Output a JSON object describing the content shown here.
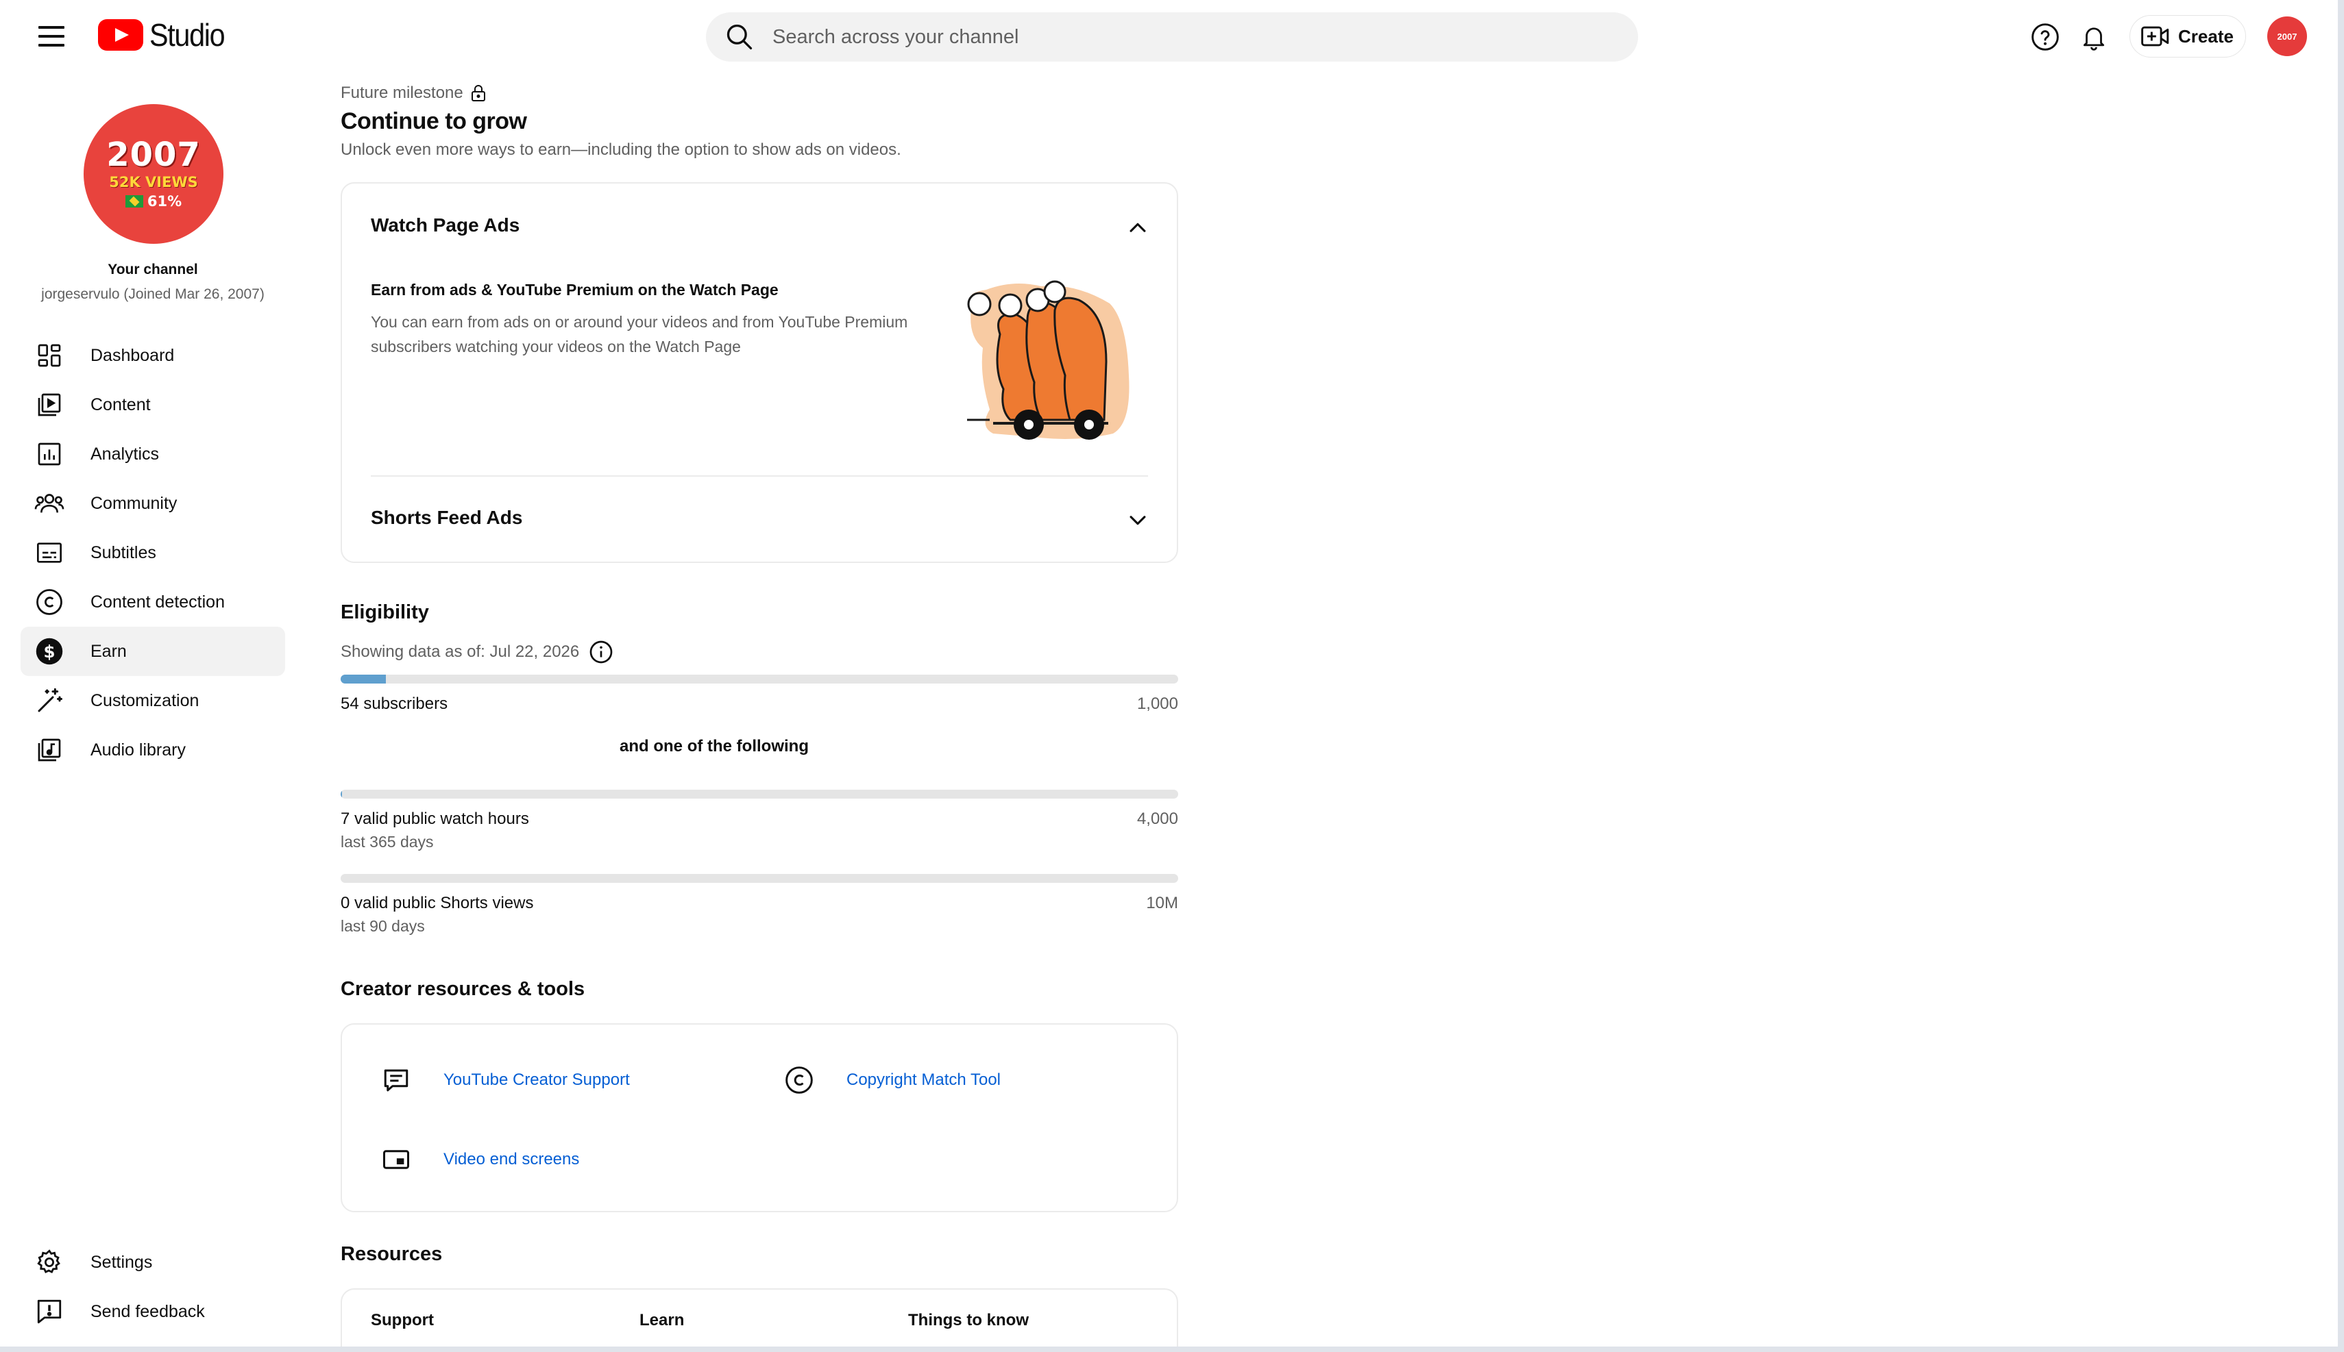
{
  "header": {
    "app_name": "Studio",
    "search_placeholder": "Search across your channel",
    "create_label": "Create",
    "avatar_text": "2007"
  },
  "sidebar": {
    "avatar": {
      "year": "2007",
      "views": "52K VIEWS",
      "percent": "61%"
    },
    "channel_title": "Your channel",
    "channel_sub": "jorgeservulo (Joined Mar 26, 2007)",
    "items": [
      {
        "label": "Dashboard",
        "icon": "dashboard-icon"
      },
      {
        "label": "Content",
        "icon": "content-icon"
      },
      {
        "label": "Analytics",
        "icon": "analytics-icon"
      },
      {
        "label": "Community",
        "icon": "community-icon"
      },
      {
        "label": "Subtitles",
        "icon": "subtitles-icon"
      },
      {
        "label": "Content detection",
        "icon": "copyright-icon"
      },
      {
        "label": "Earn",
        "icon": "dollar-icon",
        "active": true
      },
      {
        "label": "Customization",
        "icon": "magic-wand-icon"
      },
      {
        "label": "Audio library",
        "icon": "audio-library-icon"
      }
    ],
    "bottom_items": [
      {
        "label": "Settings",
        "icon": "gear-icon"
      },
      {
        "label": "Send feedback",
        "icon": "feedback-icon"
      }
    ]
  },
  "main": {
    "milestone_label": "Future milestone",
    "title": "Continue to grow",
    "subtitle": "Unlock even more ways to earn—including the option to show ads on videos.",
    "accordion": {
      "watch_page": {
        "title": "Watch Page Ads",
        "subtitle": "Earn from ads & YouTube Premium on the Watch Page",
        "description": "You can earn from ads on or around your videos and from YouTube Premium subscribers watching your videos on the Watch Page"
      },
      "shorts": {
        "title": "Shorts Feed Ads"
      }
    },
    "eligibility": {
      "title": "Eligibility",
      "as_of": "Showing data as of: Jul 22, 2026",
      "subscribers": {
        "label": "54 subscribers",
        "target": "1,000",
        "progress": 0.054
      },
      "or_text": "and one of the following",
      "watch_hours": {
        "label": "7 valid public watch hours",
        "period": "last 365 days",
        "target": "4,000",
        "progress": 0.00175
      },
      "shorts_views": {
        "label": "0 valid public Shorts views",
        "period": "last 90 days",
        "target": "10M",
        "progress": 0
      }
    },
    "tools": {
      "title": "Creator resources & tools",
      "items": [
        {
          "label": "YouTube Creator Support",
          "icon": "chat-icon"
        },
        {
          "label": "Copyright Match Tool",
          "icon": "copyright-icon"
        },
        {
          "label": "Video end screens",
          "icon": "end-screen-icon"
        }
      ]
    },
    "resources": {
      "title": "Resources",
      "columns": [
        "Support",
        "Learn",
        "Things to know"
      ]
    }
  },
  "colors": {
    "accent_link": "#065fd4",
    "brand_red": "#ff0000",
    "progress_fill": "#5f9fce",
    "active_nav_bg": "#f2f2f2"
  }
}
